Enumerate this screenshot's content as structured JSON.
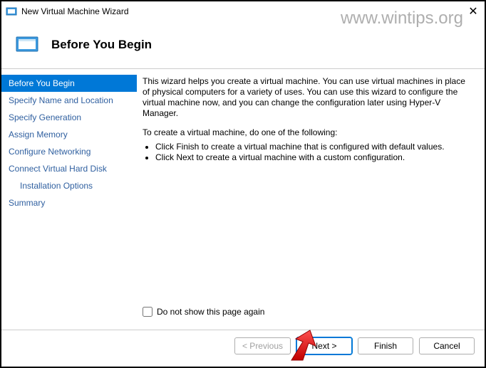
{
  "window": {
    "title": "New Virtual Machine Wizard"
  },
  "watermark": "www.wintips.org",
  "header": {
    "title": "Before You Begin"
  },
  "sidebar": {
    "items": [
      {
        "label": "Before You Begin",
        "selected": true,
        "indent": false
      },
      {
        "label": "Specify Name and Location",
        "selected": false,
        "indent": false
      },
      {
        "label": "Specify Generation",
        "selected": false,
        "indent": false
      },
      {
        "label": "Assign Memory",
        "selected": false,
        "indent": false
      },
      {
        "label": "Configure Networking",
        "selected": false,
        "indent": false
      },
      {
        "label": "Connect Virtual Hard Disk",
        "selected": false,
        "indent": false
      },
      {
        "label": "Installation Options",
        "selected": false,
        "indent": true
      },
      {
        "label": "Summary",
        "selected": false,
        "indent": false
      }
    ]
  },
  "main": {
    "description": "This wizard helps you create a virtual machine. You can use virtual machines in place of physical computers for a variety of uses. You can use this wizard to configure the virtual machine now, and you can change the configuration later using Hyper-V Manager.",
    "instruction": "To create a virtual machine, do one of the following:",
    "bullets": [
      "Click Finish to create a virtual machine that is configured with default values.",
      "Click Next to create a virtual machine with a custom configuration."
    ],
    "checkbox_label": "Do not show this page again"
  },
  "buttons": {
    "previous": "< Previous",
    "next": "Next >",
    "finish": "Finish",
    "cancel": "Cancel"
  }
}
